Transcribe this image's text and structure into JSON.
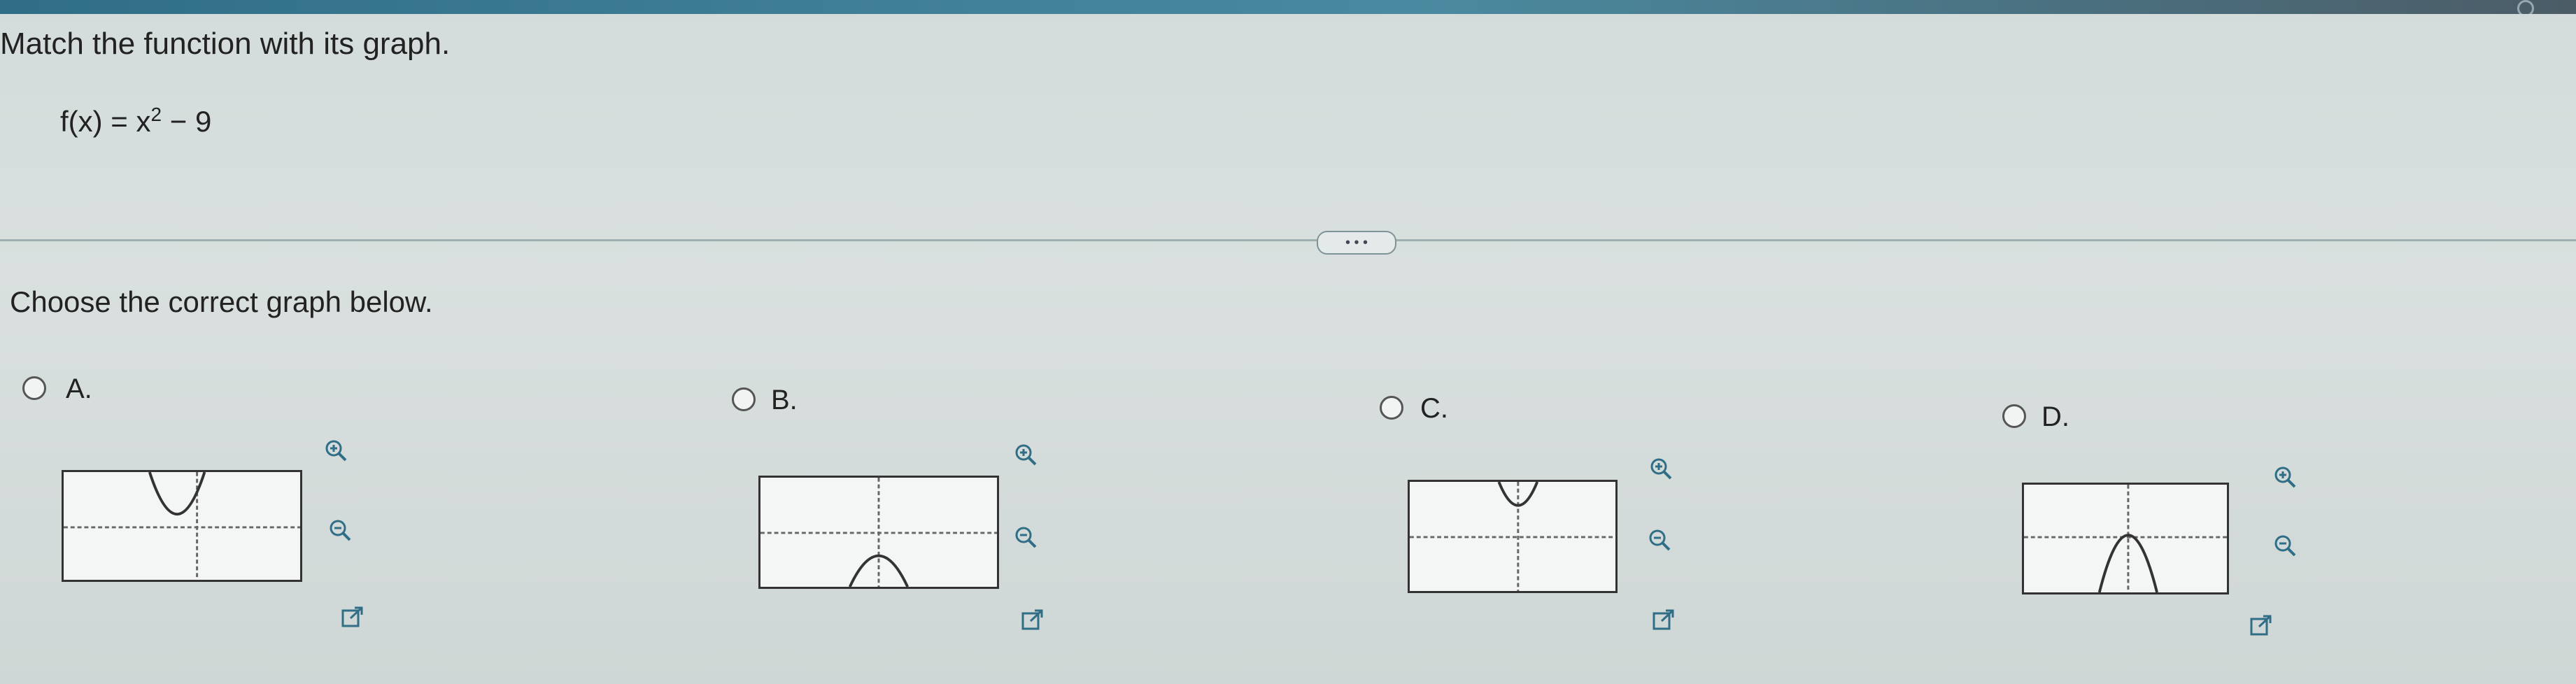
{
  "header": {
    "prompt": "Match the function with its graph."
  },
  "function": {
    "lhs": "f(x) = x",
    "exponent": "2",
    "rhs": " − 9"
  },
  "divider": {
    "more_label": "• • •"
  },
  "question": {
    "text": "Choose the correct graph below."
  },
  "options": [
    {
      "letter": "A.",
      "icons": [
        "zoom-in-icon",
        "zoom-out-icon",
        "open-window-icon"
      ]
    },
    {
      "letter": "B.",
      "icons": [
        "zoom-in-icon",
        "zoom-out-icon",
        "open-window-icon"
      ]
    },
    {
      "letter": "C.",
      "icons": [
        "zoom-in-icon",
        "zoom-out-icon",
        "open-window-icon"
      ]
    },
    {
      "letter": "D.",
      "icons": [
        "zoom-in-icon",
        "zoom-out-icon",
        "open-window-icon"
      ]
    }
  ],
  "colors": {
    "accent": "#2f6e86",
    "curve": "#333333",
    "background": "#d9e0df"
  }
}
